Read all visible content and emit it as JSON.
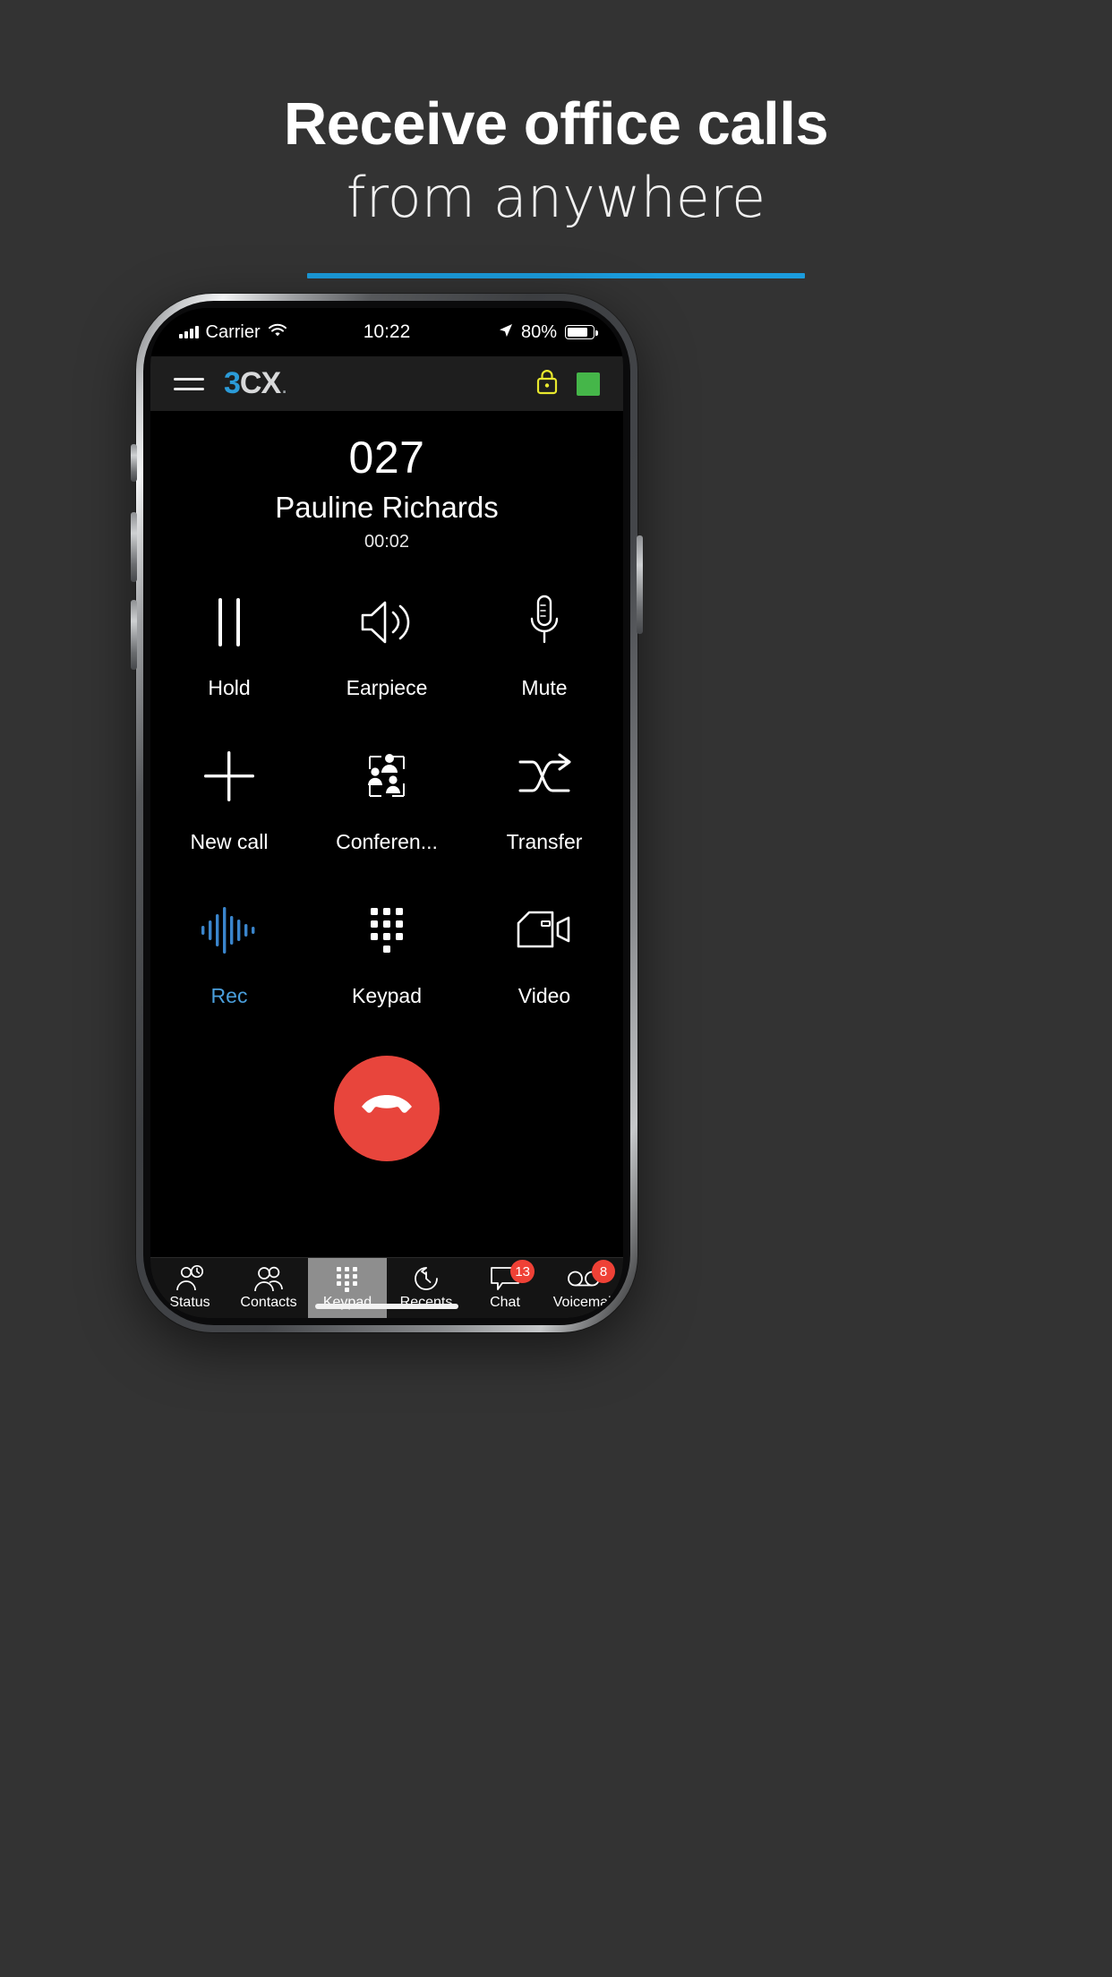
{
  "promo": {
    "title": "Receive office calls",
    "subtitle": "from anywhere",
    "accent_color": "#1b9cdd"
  },
  "statusbar": {
    "carrier": "Carrier",
    "time": "10:22",
    "battery_percent": "80%",
    "signal_icon": "cellular-bars-icon",
    "wifi_icon": "wifi-icon",
    "location_icon": "location-arrow-icon",
    "battery_icon": "battery-icon"
  },
  "appbar": {
    "menu_icon": "hamburger-menu-icon",
    "logo_3": "3",
    "logo_cx": "CX",
    "logo_dot": ".",
    "lock_icon": "lock-icon",
    "lock_color": "#e8e82e",
    "status_icon": "availability-status-square",
    "status_color": "#45b649"
  },
  "call": {
    "number": "027",
    "name": "Pauline Richards",
    "timer": "00:02",
    "controls": [
      {
        "label": "Hold",
        "icon": "pause-icon",
        "active": false
      },
      {
        "label": "Earpiece",
        "icon": "speaker-icon",
        "active": false
      },
      {
        "label": "Mute",
        "icon": "microphone-icon",
        "active": false
      },
      {
        "label": "New call",
        "icon": "plus-icon",
        "active": false
      },
      {
        "label": "Conferen...",
        "icon": "conference-icon",
        "active": false
      },
      {
        "label": "Transfer",
        "icon": "transfer-icon",
        "active": false
      },
      {
        "label": "Rec",
        "icon": "waveform-icon",
        "active": true
      },
      {
        "label": "Keypad",
        "icon": "keypad-icon",
        "active": false
      },
      {
        "label": "Video",
        "icon": "video-camera-icon",
        "active": false
      }
    ],
    "end_call_icon": "hangup-phone-icon",
    "end_call_color": "#e8453c",
    "active_color": "#4a9fdc"
  },
  "tabbar": {
    "tabs": [
      {
        "label": "Status",
        "icon": "status-person-clock-icon",
        "badge": "",
        "selected": false
      },
      {
        "label": "Contacts",
        "icon": "contacts-people-icon",
        "badge": "",
        "selected": false
      },
      {
        "label": "Keypad",
        "icon": "keypad-dots-icon",
        "badge": "",
        "selected": true
      },
      {
        "label": "Recents",
        "icon": "recents-clock-icon",
        "badge": "",
        "selected": false
      },
      {
        "label": "Chat",
        "icon": "chat-bubble-icon",
        "badge": "13",
        "selected": false
      },
      {
        "label": "Voicemail",
        "icon": "voicemail-icon",
        "badge": "8",
        "selected": false
      }
    ],
    "badge_color": "#ef4136"
  }
}
